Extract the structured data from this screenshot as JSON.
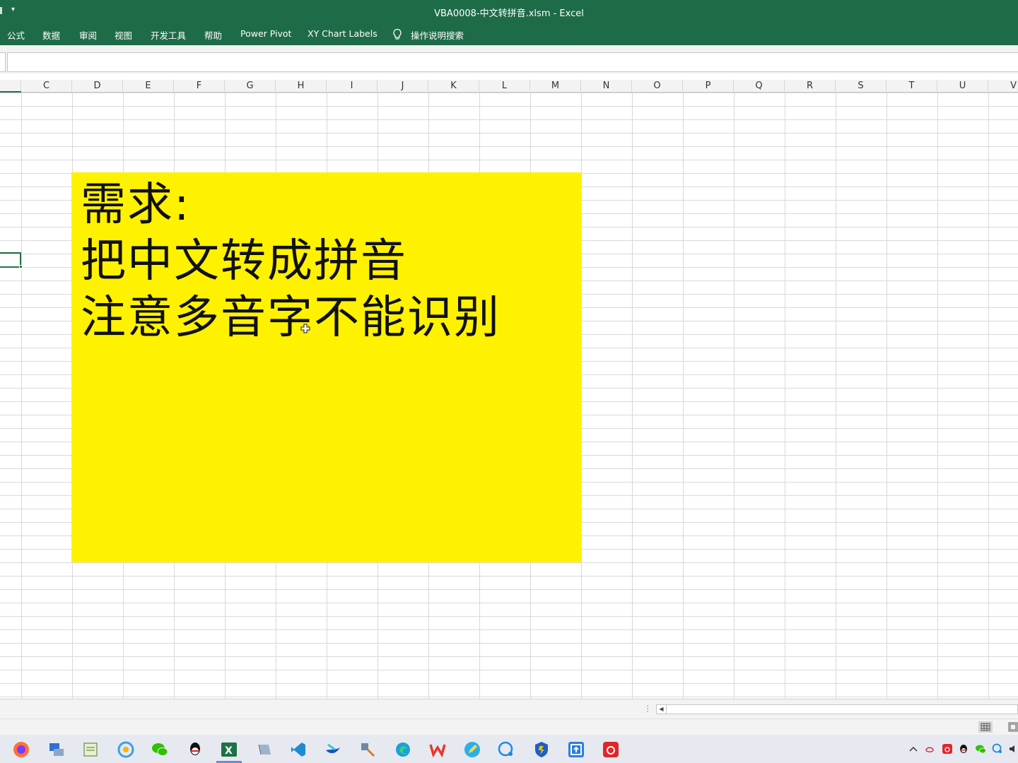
{
  "window": {
    "title": "VBA0008-中文转拼音.xlsm  -  Excel"
  },
  "ribbon": {
    "tabs": [
      "公式",
      "数据",
      "审阅",
      "视图",
      "开发工具",
      "帮助",
      "Power Pivot",
      "XY Chart Labels"
    ],
    "tell_me": "操作说明搜索"
  },
  "columns": [
    "C",
    "D",
    "E",
    "F",
    "G",
    "H",
    "I",
    "J",
    "K",
    "L",
    "M",
    "N",
    "O",
    "P",
    "Q",
    "R",
    "S",
    "T",
    "U",
    "V"
  ],
  "textbox": {
    "lines": [
      "需求:",
      "把中文转成拼音",
      "注意多音字不能识别"
    ],
    "background": "#fff200"
  },
  "colors": {
    "excel_green": "#1e6b48",
    "selection_green": "#217346"
  },
  "taskbar": {
    "icons": [
      "firefox-icon",
      "network-tool-icon",
      "notepad-icon",
      "360-browser-icon",
      "wechat-icon",
      "qq-icon",
      "excel-icon",
      "virtual-machine-icon",
      "vscode-icon",
      "feishu-icon",
      "tools-icon",
      "edge-icon",
      "wps-icon",
      "pen-icon",
      "chat-bubble-icon",
      "shield-app-icon",
      "upload-icon",
      "netease-music-icon"
    ],
    "tray": [
      "chevron-up-icon",
      "tray-app-icon",
      "tray-netease-icon",
      "tray-qq-icon",
      "tray-wechat-icon",
      "tray-chat-icon",
      "volume-icon"
    ]
  }
}
